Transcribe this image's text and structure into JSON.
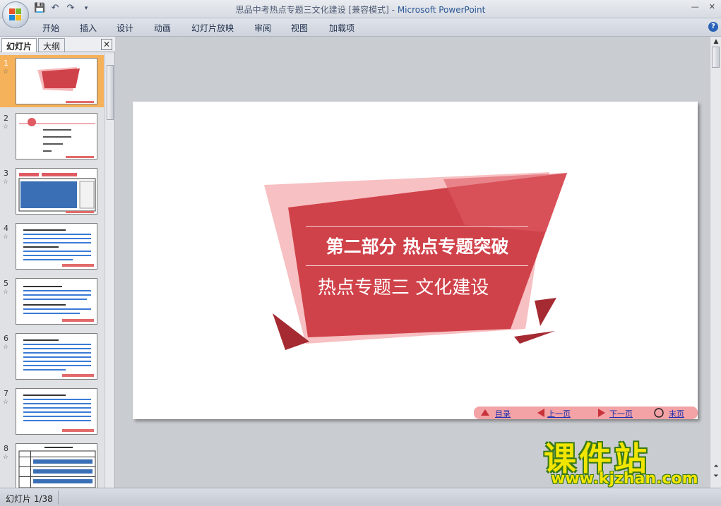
{
  "window": {
    "title": "思品中考热点专题三文化建设 [兼容模式]",
    "app_name": "Microsoft PowerPoint"
  },
  "ribbon_tabs": [
    "开始",
    "插入",
    "设计",
    "动画",
    "幻灯片放映",
    "审阅",
    "视图",
    "加载项"
  ],
  "left_pane": {
    "tabs": [
      "幻灯片",
      "大纲"
    ],
    "close_label": "✕",
    "slides": [
      {
        "num": "1",
        "selected": true
      },
      {
        "num": "2",
        "selected": false
      },
      {
        "num": "3",
        "selected": false
      },
      {
        "num": "4",
        "selected": false
      },
      {
        "num": "5",
        "selected": false
      },
      {
        "num": "6",
        "selected": false
      },
      {
        "num": "7",
        "selected": false
      },
      {
        "num": "8",
        "selected": false
      }
    ]
  },
  "slide": {
    "title": "第二部分 热点专题突破",
    "subtitle": "热点专题三 文化建设",
    "nav": {
      "toc": "目录",
      "prev": "上一页",
      "next": "下一页",
      "last": "末页"
    },
    "colors": {
      "primary_red": "#d0424a",
      "light_pink": "#f6b9bb",
      "dark_red": "#a52a32"
    }
  },
  "status": {
    "text": "幻灯片 1/38"
  },
  "watermark": {
    "brand": "课件站",
    "url": "www.kjzhan.com"
  }
}
